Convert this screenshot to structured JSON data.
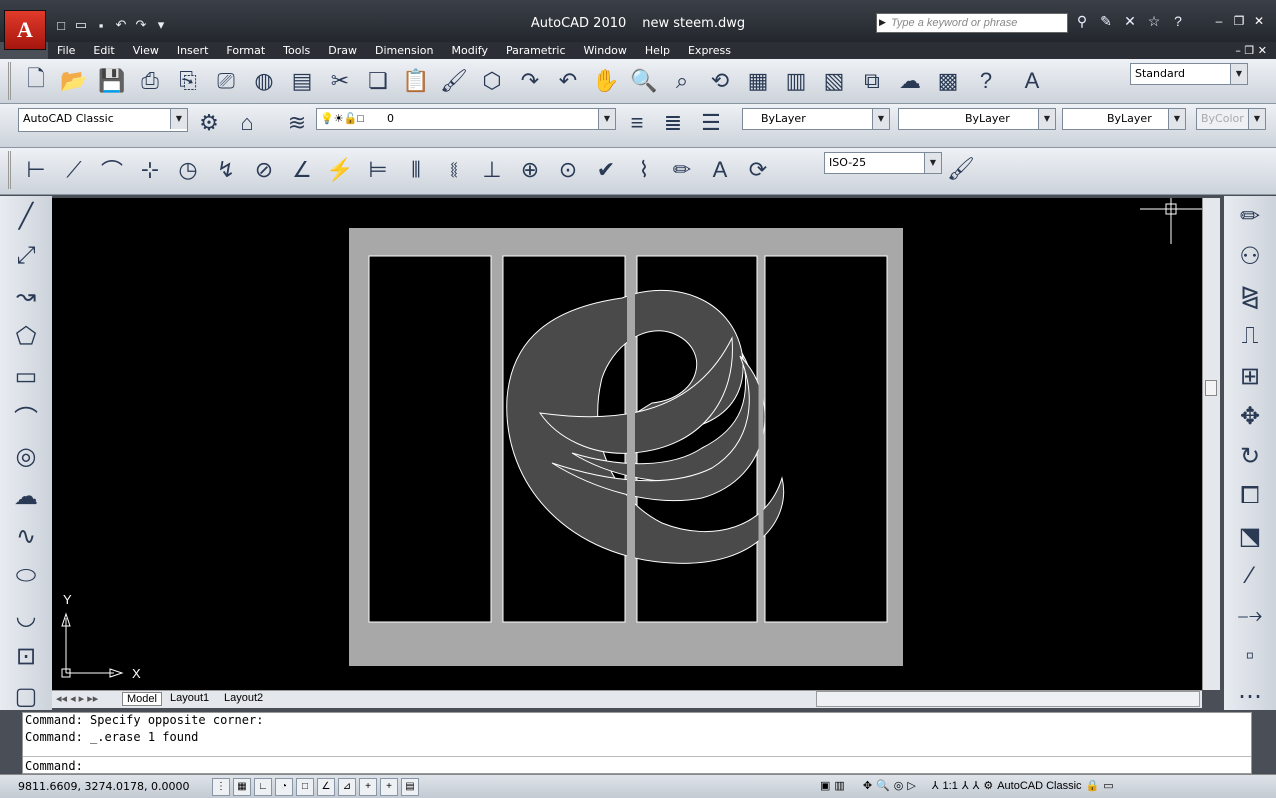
{
  "app": {
    "title": "AutoCAD 2010",
    "filename": "new steem.dwg",
    "logo_letter": "A",
    "search_placeholder": "Type a keyword or phrase"
  },
  "menu": [
    "File",
    "Edit",
    "View",
    "Insert",
    "Format",
    "Tools",
    "Draw",
    "Dimension",
    "Modify",
    "Parametric",
    "Window",
    "Help",
    "Express"
  ],
  "toolbar": {
    "text_style": "Standard",
    "workspace": "AutoCAD Classic",
    "layer": "0",
    "color": "ByLayer",
    "linetype": "ByLayer",
    "lineweight": "ByLayer",
    "plot_style": "ByColor",
    "dim_style": "ISO-25"
  },
  "layout_tabs": [
    "Model",
    "Layout1",
    "Layout2"
  ],
  "ucs": {
    "x_label": "X",
    "y_label": "Y"
  },
  "command_history": [
    "Command: Specify opposite corner:",
    "Command: _.erase 1 found"
  ],
  "command_prompt": "Command:",
  "status": {
    "coordinates": "9811.6609, 3274.0178, 0.0000",
    "annotation_scale": "1:1",
    "workspace": "AutoCAD Classic"
  },
  "colors": {
    "canvas": "#000000",
    "frame": "#a8a8a8",
    "logo_fill": "#4a4a4a",
    "logo_stroke": "#ffffff",
    "title_bar": "#2b2f35"
  }
}
